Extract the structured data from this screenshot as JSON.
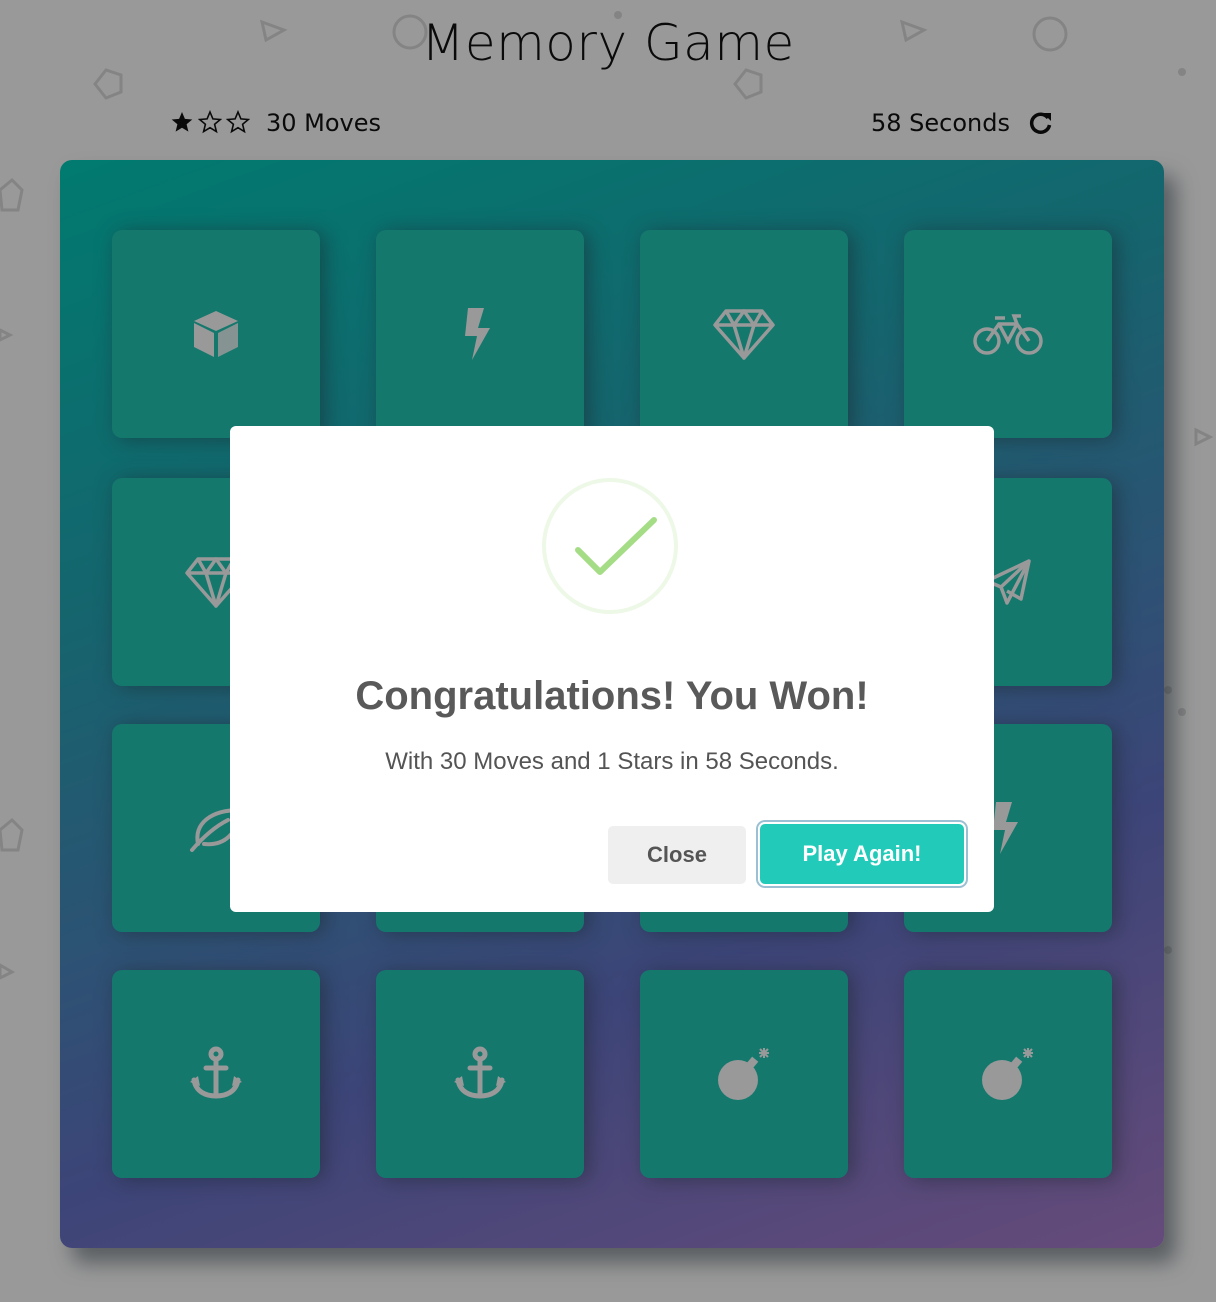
{
  "header": {
    "title": "Memory Game"
  },
  "score_panel": {
    "stars": [
      {
        "filled": true,
        "icon": "star-filled-icon"
      },
      {
        "filled": false,
        "icon": "star-outline-icon"
      },
      {
        "filled": false,
        "icon": "star-outline-icon"
      }
    ],
    "moves_text": "30 Moves",
    "timer_text": "58 Seconds",
    "restart_icon": "refresh-icon"
  },
  "deck": {
    "columns": 4,
    "rows": 4,
    "cards": [
      {
        "icon": "cube-icon",
        "state": "match"
      },
      {
        "icon": "bolt-icon",
        "state": "match"
      },
      {
        "icon": "diamond-icon",
        "state": "match"
      },
      {
        "icon": "bicycle-icon",
        "state": "match"
      },
      {
        "icon": "diamond-icon",
        "state": "match"
      },
      {
        "icon": "hidden",
        "state": "match"
      },
      {
        "icon": "hidden",
        "state": "match"
      },
      {
        "icon": "paper-plane-icon",
        "state": "match"
      },
      {
        "icon": "leaf-icon",
        "state": "match"
      },
      {
        "icon": "hidden",
        "state": "match"
      },
      {
        "icon": "hidden",
        "state": "match"
      },
      {
        "icon": "bolt-icon",
        "state": "match"
      },
      {
        "icon": "anchor-icon",
        "state": "match"
      },
      {
        "icon": "anchor-icon",
        "state": "match"
      },
      {
        "icon": "bomb-icon",
        "state": "match"
      },
      {
        "icon": "bomb-icon",
        "state": "match"
      }
    ]
  },
  "modal": {
    "icon": "success-check-icon",
    "title": "Congratulations! You Won!",
    "text": "With 30 Moves and 1 Stars in 58 Seconds.",
    "close_label": "Close",
    "play_again_label": "Play Again!"
  },
  "colors": {
    "card": "#22c8b6",
    "deck_gradient_start": "#02ccba",
    "deck_gradient_end": "#aa7ecd",
    "play_button": "#22cbb9",
    "check": "#a5dc86",
    "overlay": "rgba(0,0,0,0.4)"
  }
}
